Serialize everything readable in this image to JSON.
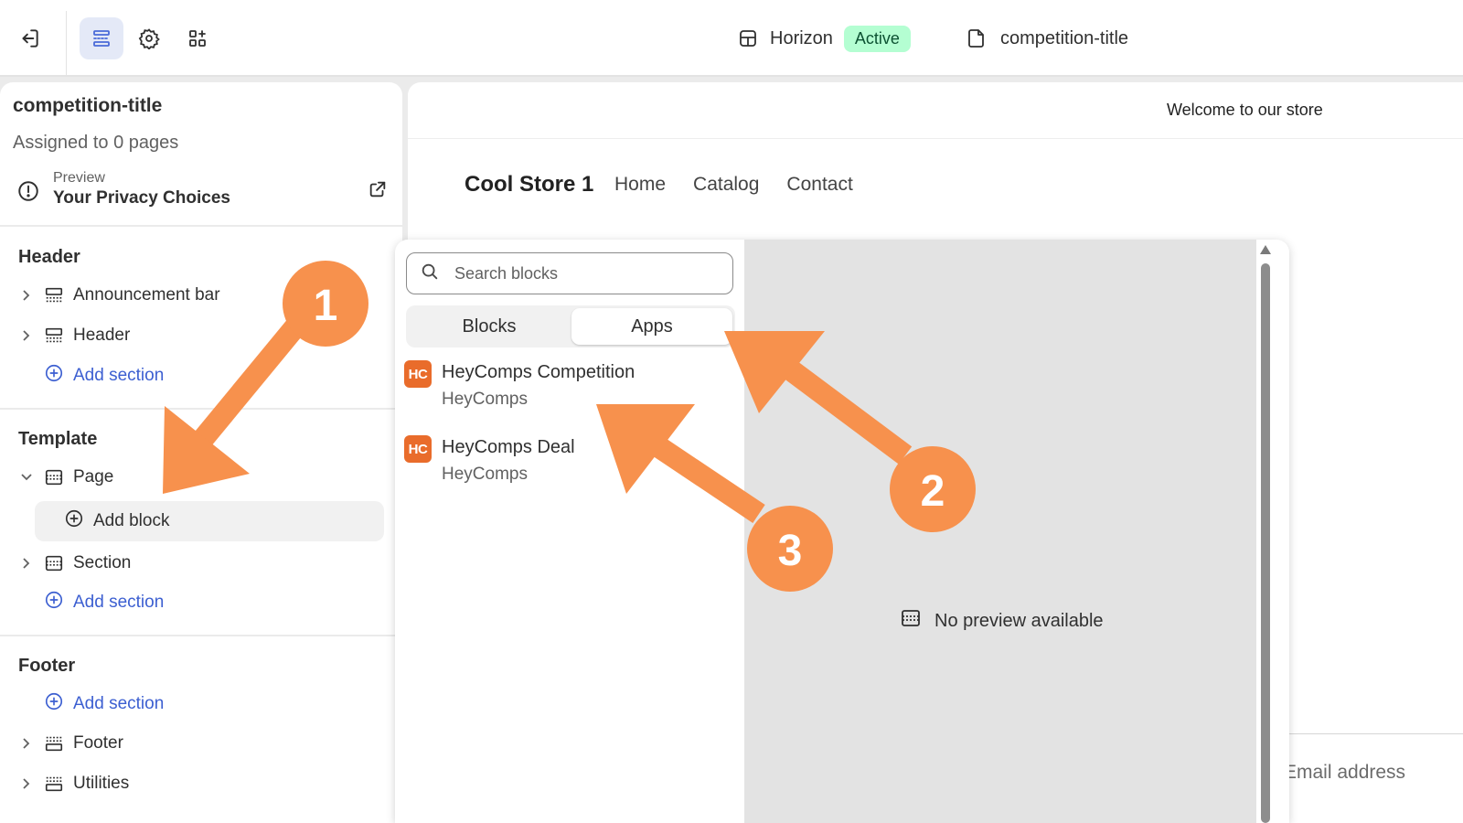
{
  "topbar": {
    "theme_name": "Horizon",
    "theme_status": "Active",
    "page_name": "competition-title",
    "colors": {
      "active_bg": "#b4fed2",
      "active_text": "#0c5132",
      "selected_icon": "#4a6ad8"
    }
  },
  "sidebar": {
    "title": "competition-title",
    "subtitle": "Assigned to 0 pages",
    "preview_label": "Preview",
    "preview_value": "Your Privacy Choices",
    "header_group": {
      "heading": "Header",
      "items": [
        {
          "label": "Announcement bar"
        },
        {
          "label": "Header"
        }
      ],
      "add_label": "Add section"
    },
    "template_group": {
      "heading": "Template",
      "page_label": "Page",
      "add_block_label": "Add block",
      "section_label": "Section",
      "add_label": "Add section"
    },
    "footer_group": {
      "heading": "Footer",
      "add_label": "Add section",
      "items": [
        {
          "label": "Footer"
        },
        {
          "label": "Utilities"
        }
      ]
    }
  },
  "storefront": {
    "announcement": "Welcome to our store",
    "store_name": "Cool Store 1",
    "nav": [
      "Home",
      "Catalog",
      "Contact"
    ],
    "email_placeholder": "Email address"
  },
  "picker": {
    "search_placeholder": "Search blocks",
    "tabs": [
      {
        "label": "Blocks",
        "selected": false
      },
      {
        "label": "Apps",
        "selected": true
      }
    ],
    "apps": [
      {
        "logo": "HC",
        "name": "HeyComps Competition",
        "developer": "HeyComps"
      },
      {
        "logo": "HC",
        "name": "HeyComps Deal",
        "developer": "HeyComps"
      }
    ],
    "no_preview": "No preview available"
  },
  "annotations": {
    "color": "#f7914d",
    "labels": [
      "1",
      "2",
      "3"
    ]
  }
}
